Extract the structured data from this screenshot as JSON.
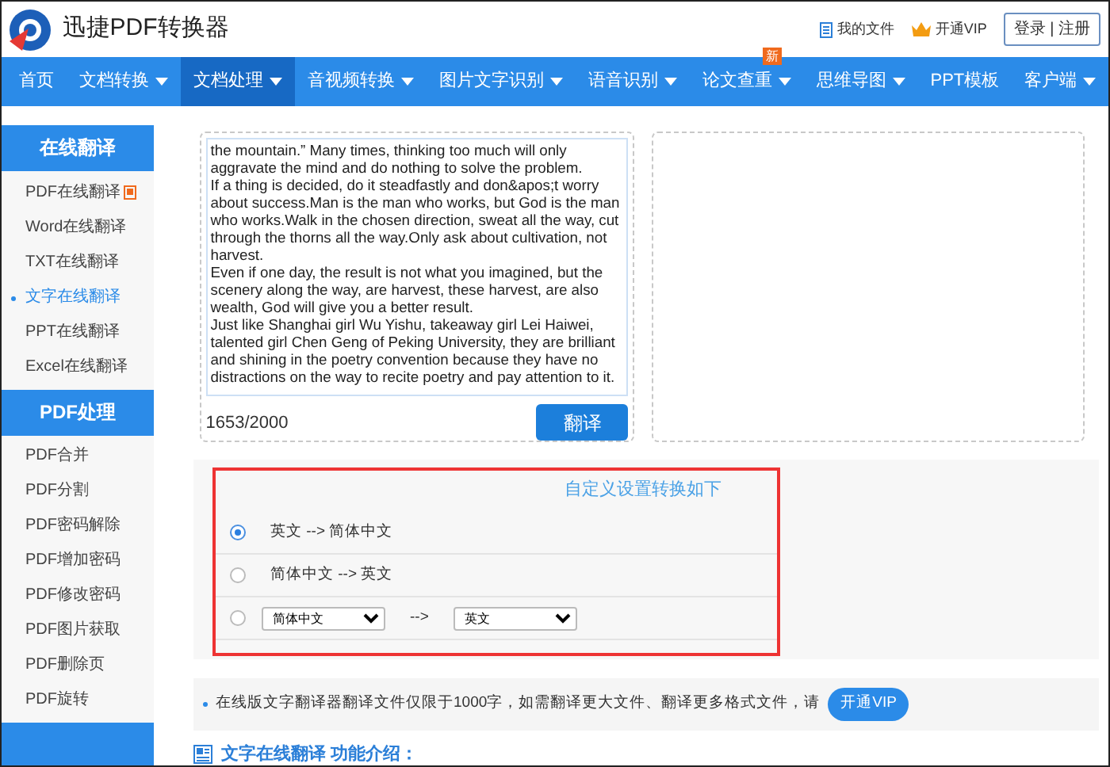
{
  "app": {
    "title": "迅捷PDF转换器"
  },
  "header_links": [
    {
      "kind": "files",
      "label": "我的文件"
    },
    {
      "kind": "vip",
      "label": "开通VIP"
    }
  ],
  "auth": {
    "login": "登录",
    "separator": "|",
    "register": "注册"
  },
  "nav": [
    {
      "label": "首页",
      "dropdown": false,
      "selected": false
    },
    {
      "label": "文档转换",
      "dropdown": true,
      "selected": false
    },
    {
      "label": "文档处理",
      "dropdown": true,
      "selected": true
    },
    {
      "label": "音视频转换",
      "dropdown": true,
      "selected": false
    },
    {
      "label": "图片文字识别",
      "dropdown": true,
      "selected": false
    },
    {
      "label": "语音识别",
      "dropdown": true,
      "selected": false
    },
    {
      "label": "论文查重",
      "dropdown": true,
      "selected": false,
      "badge": "新"
    },
    {
      "label": "思维导图",
      "dropdown": true,
      "selected": false
    },
    {
      "label": "PPT模板",
      "dropdown": false,
      "selected": false
    },
    {
      "label": "客户端",
      "dropdown": true,
      "selected": false
    }
  ],
  "sidebar": [
    {
      "title": "在线翻译",
      "items": [
        {
          "label": "PDF在线翻译",
          "hot": true,
          "selected": false
        },
        {
          "label": "Word在线翻译",
          "hot": false,
          "selected": false
        },
        {
          "label": "TXT在线翻译",
          "hot": false,
          "selected": false
        },
        {
          "label": "文字在线翻译",
          "hot": false,
          "selected": true
        },
        {
          "label": "PPT在线翻译",
          "hot": false,
          "selected": false
        },
        {
          "label": "Excel在线翻译",
          "hot": false,
          "selected": false
        }
      ]
    },
    {
      "title": "PDF处理",
      "items": [
        {
          "label": "PDF合并",
          "hot": false,
          "selected": false
        },
        {
          "label": "PDF分割",
          "hot": false,
          "selected": false
        },
        {
          "label": "PDF密码解除",
          "hot": false,
          "selected": false
        },
        {
          "label": "PDF增加密码",
          "hot": false,
          "selected": false
        },
        {
          "label": "PDF修改密码",
          "hot": false,
          "selected": false
        },
        {
          "label": "PDF图片获取",
          "hot": false,
          "selected": false
        },
        {
          "label": "PDF删除页",
          "hot": false,
          "selected": false
        },
        {
          "label": "PDF旋转",
          "hot": false,
          "selected": false
        }
      ]
    }
  ],
  "translator": {
    "paragraphs": [
      "the mountain.” Many times, thinking too much will only aggravate the mind and do nothing to solve the problem.",
      "If a thing is decided, do it steadfastly and don&apos;t worry about success.Man is the man who works, but God is the man who works.Walk in the chosen direction, sweat all the way, cut through the thorns all the way.Only ask about cultivation, not harvest.",
      "Even if one day, the result is not what you imagined, but the scenery along the way, are harvest, these harvest, are also wealth, God will give you a better result.",
      "Just like Shanghai girl Wu Yishu, takeaway girl Lei Haiwei, talented girl Chen Geng of Peking University, they are brilliant and shining in the poetry convention because they have no distractions on the way to recite poetry and pay attention to it."
    ],
    "counter": "1653/2000",
    "button": "翻译"
  },
  "options": {
    "title": "自定义设置转换如下",
    "rows": [
      {
        "kind": "fixed",
        "label": "英文 --> 简体中文",
        "selected": true
      },
      {
        "kind": "fixed",
        "label": "简体中文 --> 英文",
        "selected": false
      },
      {
        "kind": "custom",
        "from": "简体中文",
        "arrow": "-->",
        "to": "英文",
        "selected": false
      }
    ]
  },
  "notice": {
    "text": "在线版文字翻译器翻译文件仅限于1000字，如需翻译更大文件、翻译更多格式文件，请",
    "button": "开通VIP"
  },
  "section": {
    "title": "文字在线翻译 功能介绍："
  }
}
